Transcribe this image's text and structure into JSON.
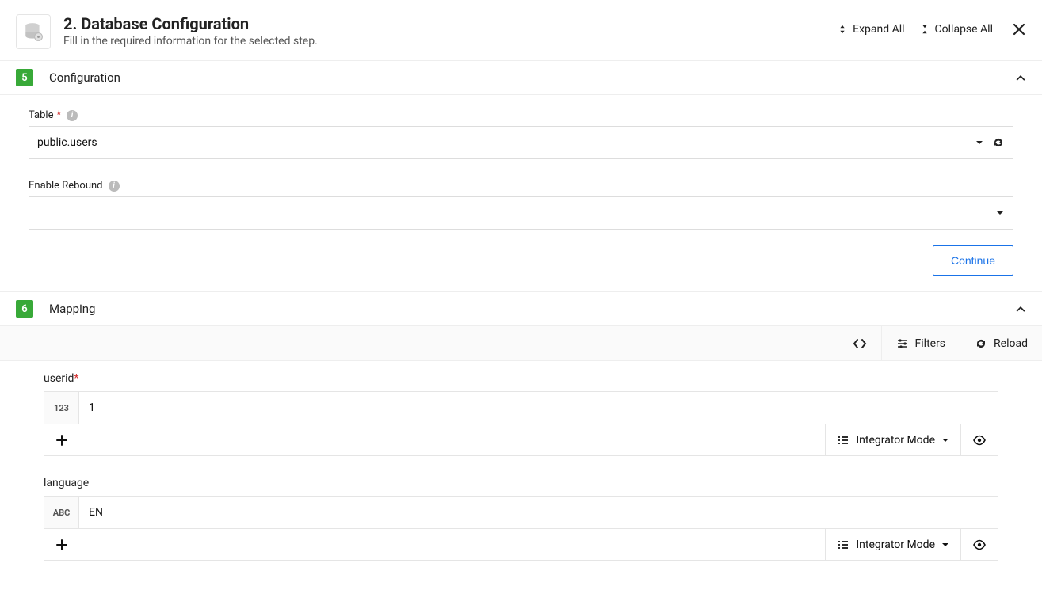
{
  "header": {
    "title": "2. Database Configuration",
    "subtitle": "Fill in the required information for the selected step.",
    "expand_all": "Expand All",
    "collapse_all": "Collapse All"
  },
  "sections": {
    "configuration": {
      "number": "5",
      "label": "Configuration",
      "table_label": "Table",
      "table_value": "public.users",
      "enable_rebound_label": "Enable Rebound",
      "enable_rebound_value": "",
      "continue_label": "Continue"
    },
    "mapping": {
      "number": "6",
      "label": "Mapping",
      "filters_label": "Filters",
      "reload_label": "Reload",
      "integrator_mode": "Integrator Mode",
      "fields": [
        {
          "name": "userid",
          "required": true,
          "type": "123",
          "value": "1"
        },
        {
          "name": "language",
          "required": false,
          "type": "ABC",
          "value": "EN"
        }
      ]
    }
  }
}
